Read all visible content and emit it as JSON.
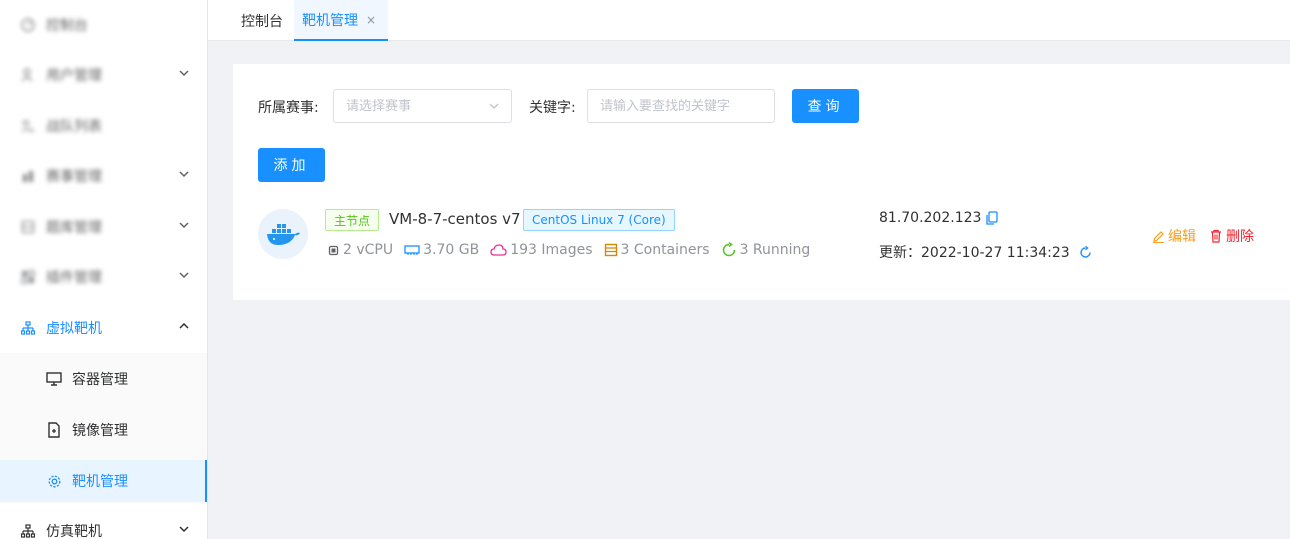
{
  "sidebar": {
    "items": [
      {
        "label": "控制台",
        "icon": "dashboard-icon"
      },
      {
        "label": "用户管理",
        "icon": "user-icon"
      },
      {
        "label": "战队列表",
        "icon": "team-icon"
      },
      {
        "label": "赛事管理",
        "icon": "trophy-icon"
      },
      {
        "label": "题库管理",
        "icon": "database-icon"
      },
      {
        "label": "插件管理",
        "icon": "plugin-icon"
      },
      {
        "label": "虚拟靶机",
        "icon": "network-icon"
      },
      {
        "label": "仿真靶机",
        "icon": "network-icon"
      }
    ],
    "subitems": [
      {
        "label": "容器管理",
        "icon": "monitor-icon"
      },
      {
        "label": "镜像管理",
        "icon": "file-icon"
      },
      {
        "label": "靶机管理",
        "icon": "gear-icon"
      }
    ]
  },
  "tabs": [
    {
      "label": "控制台"
    },
    {
      "label": "靶机管理",
      "close": "×"
    }
  ],
  "filter": {
    "competition_label": "所属赛事:",
    "competition_placeholder": "请选择赛事",
    "keyword_label": "关键字:",
    "keyword_placeholder": "请输入要查找的关键字",
    "search_button": "查询",
    "add_button": "添加"
  },
  "host": {
    "role_badge": "主节点",
    "name": "VM-8-7-centos v7",
    "os_badge": "CentOS Linux 7 (Core)",
    "cpu": "2 vCPU",
    "memory": "3.70 GB",
    "images": "193 Images",
    "containers": "3 Containers",
    "running": "3 Running",
    "ip": "81.70.202.123",
    "updated": "更新：2022-10-27 11:34:23",
    "edit_label": "编辑",
    "delete_label": "删除"
  },
  "colors": {
    "primary": "#1890ff",
    "edit": "#fa9d1a",
    "delete": "#f5222d",
    "green": "#52c41a",
    "memory_icon": "#1890ff",
    "images_icon": "#eb2f96",
    "containers_icon": "#d48806"
  }
}
